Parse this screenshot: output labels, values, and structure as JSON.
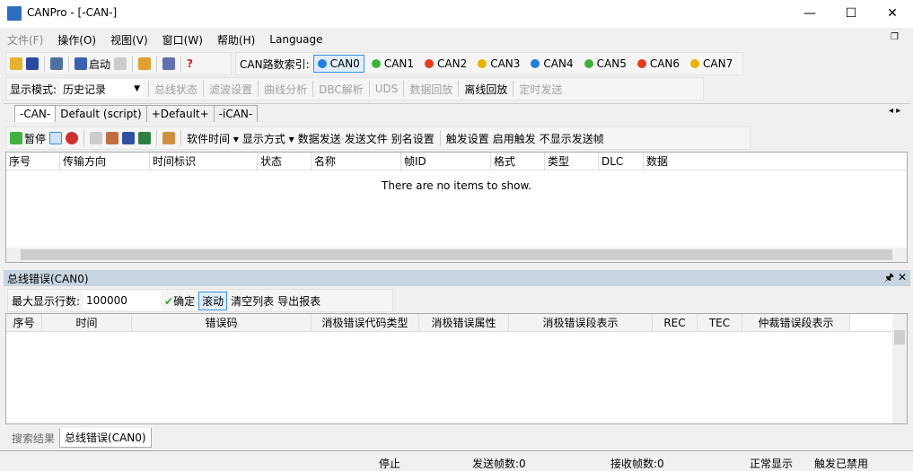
{
  "window": {
    "title": "CANPro - [-CAN-]",
    "minimize": "—",
    "maximize": "☐",
    "close": "✕"
  },
  "menu": [
    "文件(F)",
    "操作(O)",
    "视图(V)",
    "窗口(W)",
    "帮助(H)",
    "Language"
  ],
  "toolbar1": {
    "start": "启动",
    "can_index_label": "CAN路数索引:",
    "channels": [
      {
        "name": "CAN0",
        "color": "#1e7fe0"
      },
      {
        "name": "CAN1",
        "color": "#3cb43c"
      },
      {
        "name": "CAN2",
        "color": "#e83a20"
      },
      {
        "name": "CAN3",
        "color": "#e8b400"
      },
      {
        "name": "CAN4",
        "color": "#1e7fe0"
      },
      {
        "name": "CAN5",
        "color": "#3cb43c"
      },
      {
        "name": "CAN6",
        "color": "#e83a20"
      },
      {
        "name": "CAN7",
        "color": "#e8b400"
      }
    ]
  },
  "toolbar2": {
    "mode_label": "显示模式:",
    "mode_value": "历史记录",
    "items": [
      "总线状态",
      "滤波设置",
      "曲线分析",
      "DBC解析",
      "UDS",
      "数据回放",
      "离线回放",
      "定时发送"
    ]
  },
  "doc_tabs": [
    "-CAN-",
    "Default (script)",
    "+Default+",
    "-iCAN-"
  ],
  "toolbar3": {
    "pause": "暂停",
    "items": [
      "软件时间 ▾",
      "显示方式 ▾",
      "数据发送",
      "发送文件",
      "别名设置",
      "触发设置",
      "启用触发",
      "不显示发送帧"
    ]
  },
  "main_table": {
    "columns": [
      "序号",
      "传输方向",
      "时间标识",
      "状态",
      "名称",
      "帧ID",
      "格式",
      "类型",
      "DLC",
      "数据"
    ],
    "empty": "There are no items to show."
  },
  "error_panel": {
    "title": "总线错误(CAN0)",
    "pin": "🖈",
    "close": "✕",
    "max_rows_label": "最大显示行数:",
    "max_rows_value": "100000",
    "confirm": "确定",
    "scroll": "滚动",
    "clear": "清空列表",
    "export": "导出报表",
    "columns": [
      "序号",
      "时间",
      "错误码",
      "消极错误代码类型",
      "消极错误属性",
      "消极错误段表示",
      "REC",
      "TEC",
      "仲裁错误段表示"
    ]
  },
  "bottom_tabs": [
    "搜索结果",
    "总线错误(CAN0)"
  ],
  "status": [
    "停止",
    "发送帧数:0",
    "接收帧数:0",
    "正常显示",
    "触发已禁用"
  ]
}
